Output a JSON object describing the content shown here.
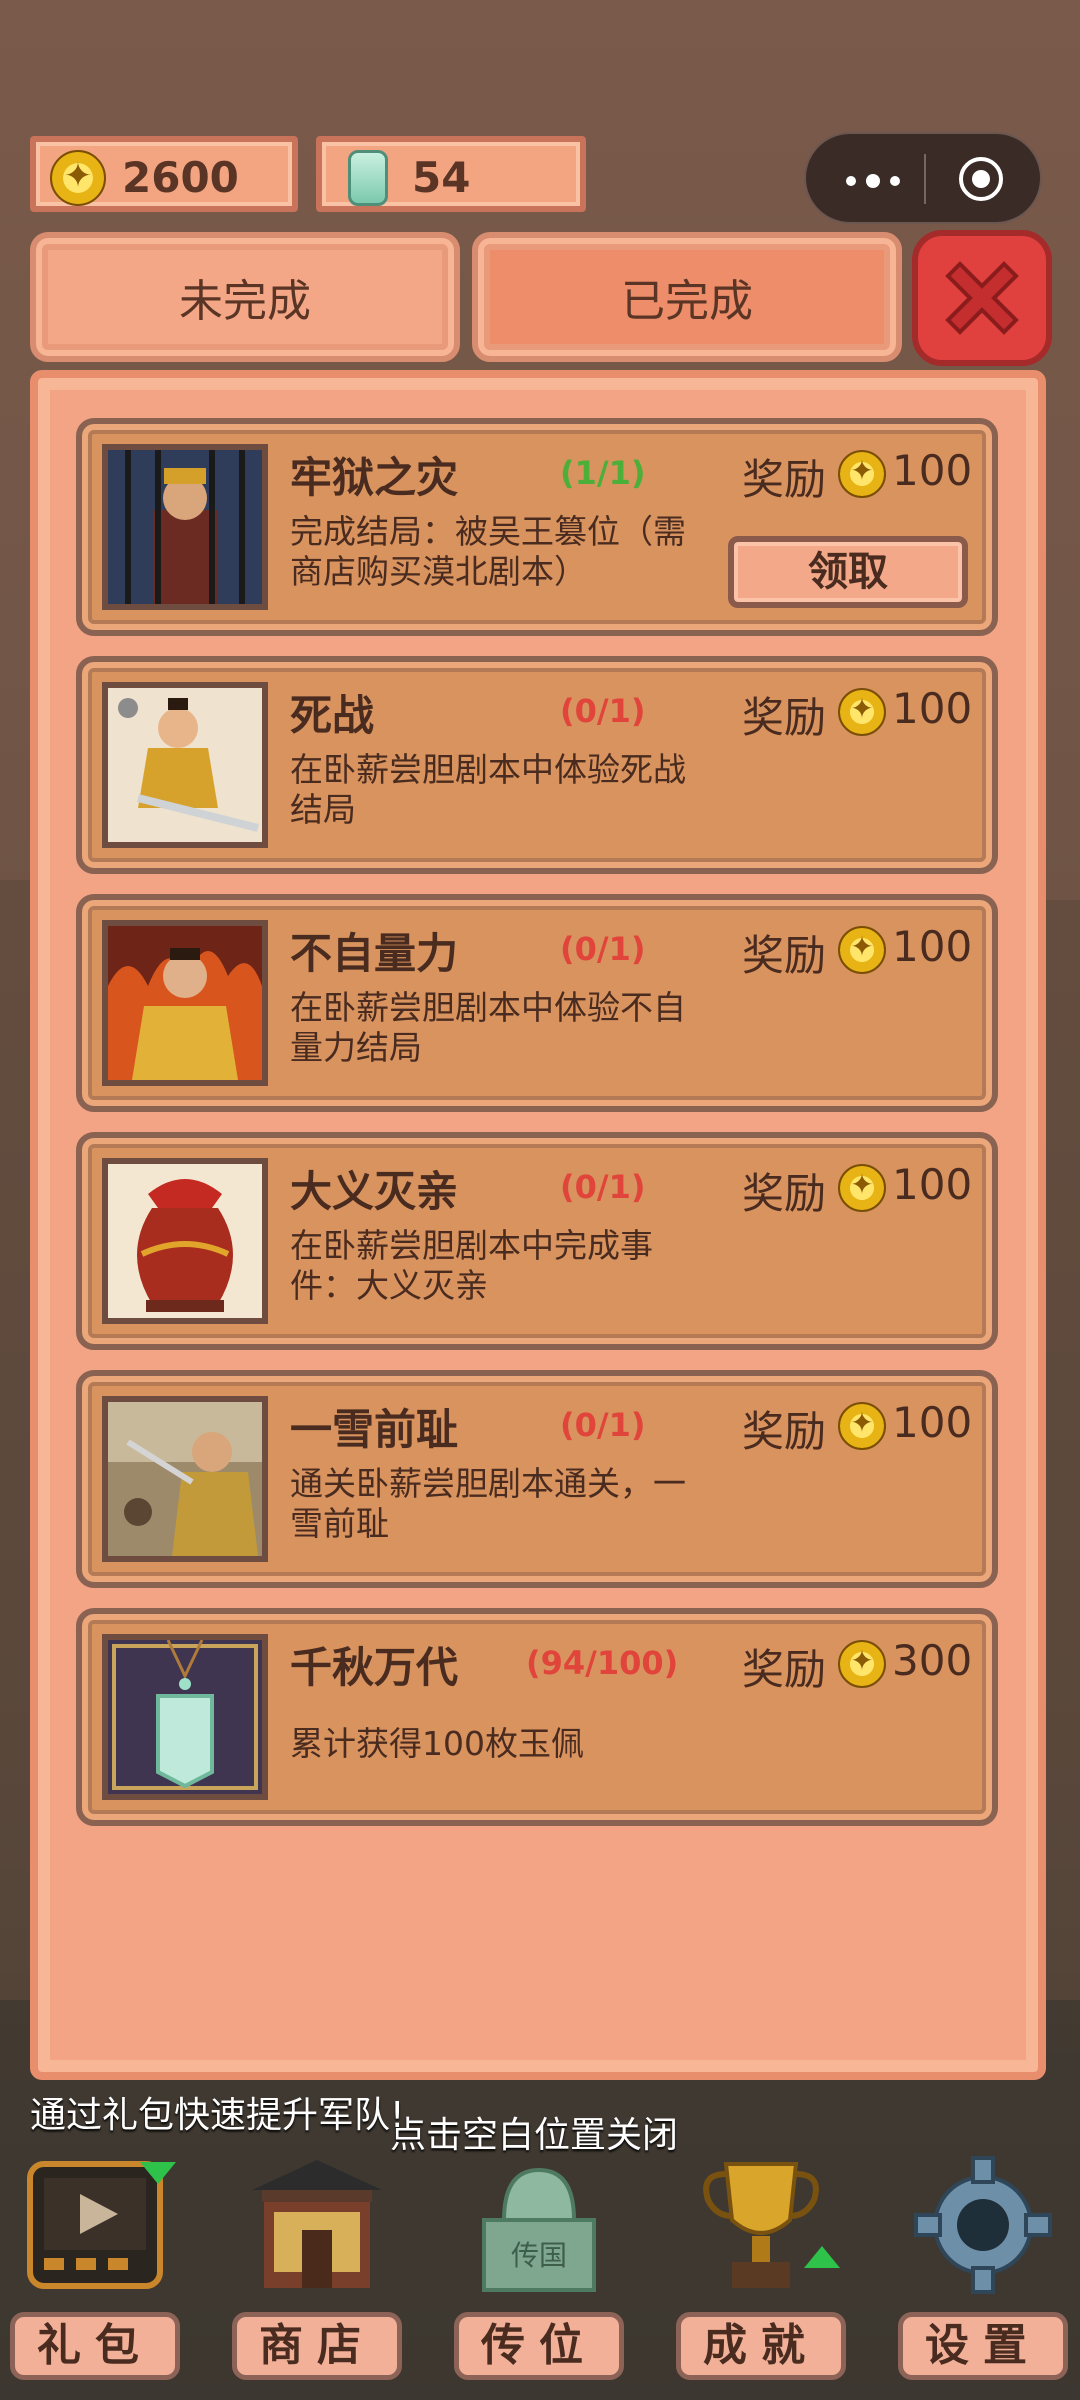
{
  "resources": {
    "coins": "2600",
    "jade": "54"
  },
  "tabs": [
    {
      "label": "未完成"
    },
    {
      "label": "已完成"
    }
  ],
  "achievements": [
    {
      "title": "牢狱之灾",
      "progress": "(1/1)",
      "progress_color": "#4caf3a",
      "desc": "完成结局：被吴王篡位（需商店购买漠北剧本）",
      "reward_label": "奖励",
      "reward": "100",
      "claim_label": "领取",
      "icon": "prisoner-portrait"
    },
    {
      "title": "死战",
      "progress": "(0/1)",
      "progress_color": "#e0443a",
      "desc": "在卧薪尝胆剧本中体验死战结局",
      "reward_label": "奖励",
      "reward": "100",
      "icon": "warrior-portrait"
    },
    {
      "title": "不自量力",
      "progress": "(0/1)",
      "progress_color": "#e0443a",
      "desc": "在卧薪尝胆剧本中体验不自量力结局",
      "reward_label": "奖励",
      "reward": "100",
      "icon": "emperor-fire-portrait"
    },
    {
      "title": "大义灭亲",
      "progress": "(0/1)",
      "progress_color": "#e0443a",
      "desc": "在卧薪尝胆剧本中完成事件：大义灭亲",
      "reward_label": "奖励",
      "reward": "100",
      "icon": "wine-jar"
    },
    {
      "title": "一雪前耻",
      "progress": "(0/1)",
      "progress_color": "#e0443a",
      "desc": "通关卧薪尝胆剧本通关，一雪前耻",
      "reward_label": "奖励",
      "reward": "100",
      "icon": "battle-general"
    },
    {
      "title": "千秋万代",
      "progress": "(94/100)",
      "progress_color": "#e0443a",
      "desc": "累计获得100枚玉佩",
      "reward_label": "奖励",
      "reward": "300",
      "icon": "jade-pendant"
    }
  ],
  "hints": {
    "promo": "通过礼包快速提升军队!",
    "close_hint": "点击空白位置关闭"
  },
  "nav": [
    {
      "label": "礼包",
      "icon": "video-gift-icon"
    },
    {
      "label": "商店",
      "icon": "shop-icon"
    },
    {
      "label": "传位",
      "icon": "jade-seal-icon"
    },
    {
      "label": "成就",
      "icon": "trophy-icon"
    },
    {
      "label": "设置",
      "icon": "gear-icon"
    }
  ]
}
